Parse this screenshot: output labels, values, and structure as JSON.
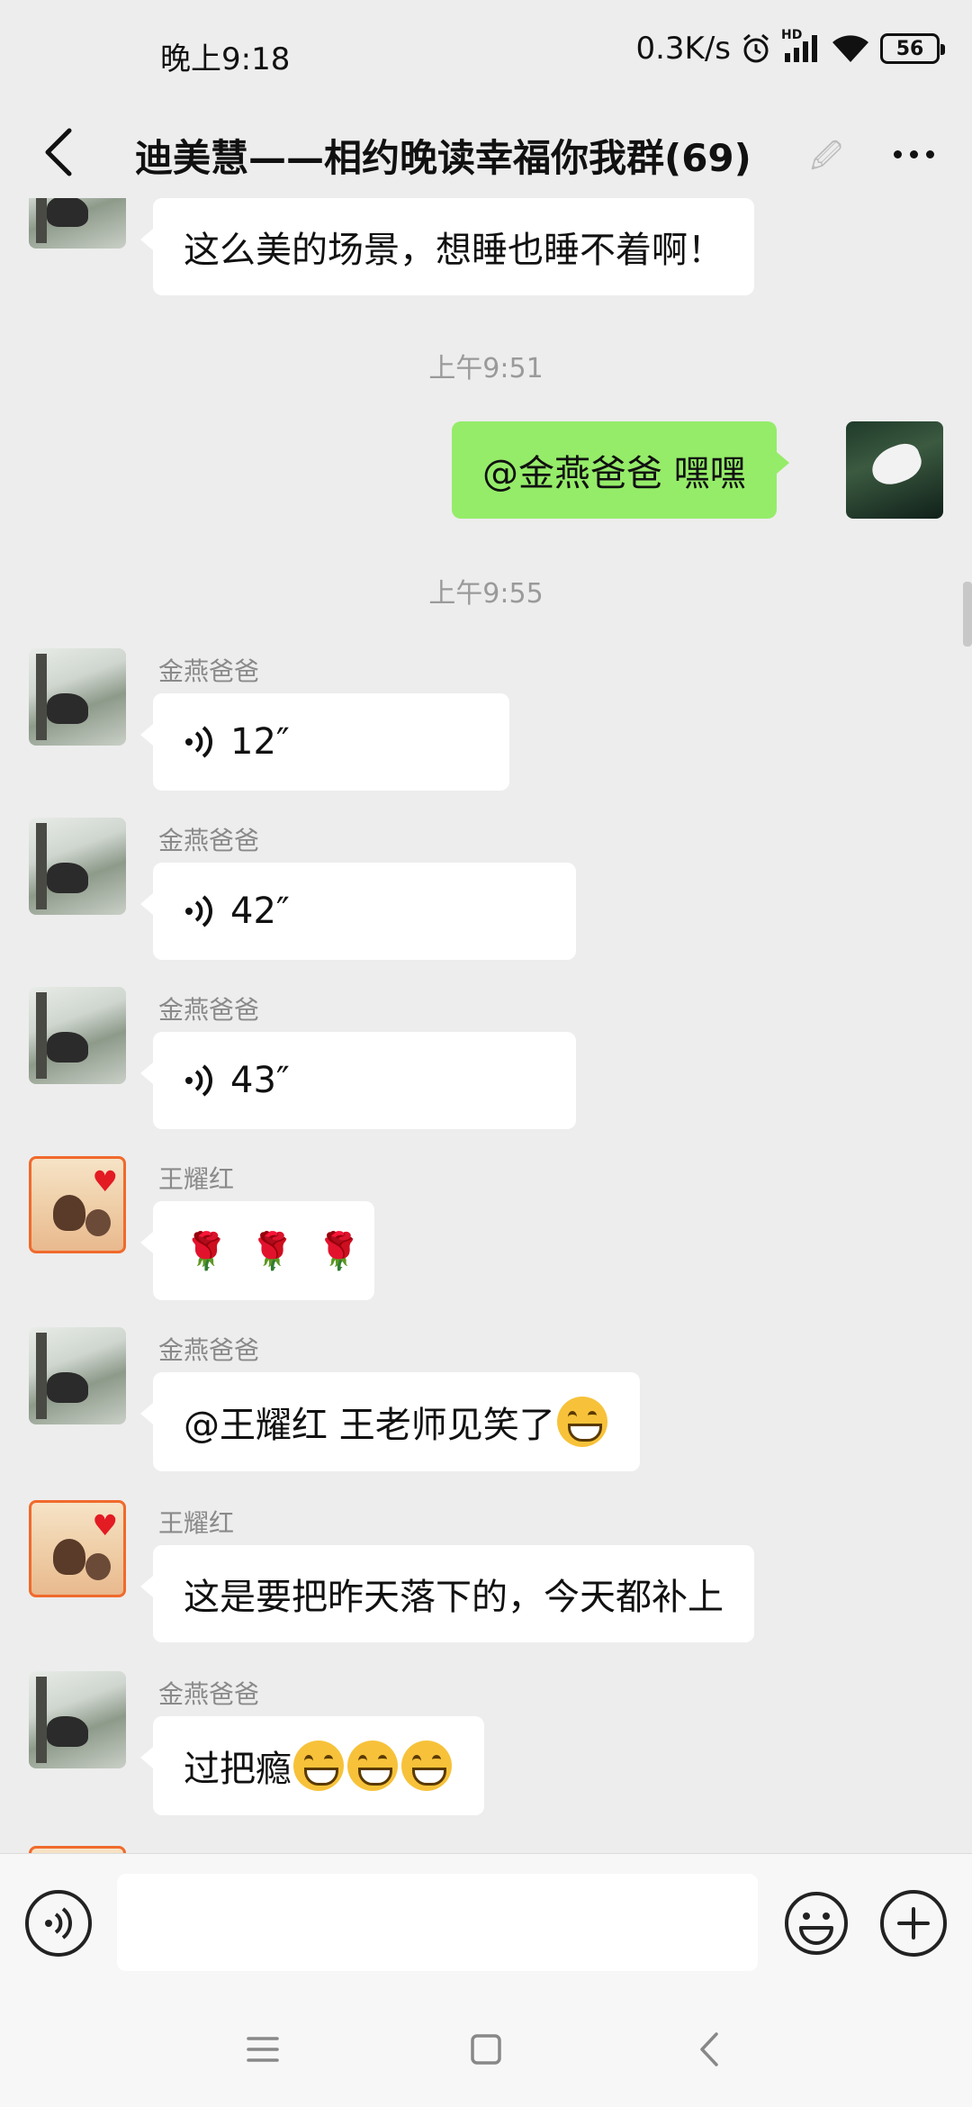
{
  "status_bar": {
    "time": "晚上9:18",
    "network_speed": "0.3K/s",
    "signal_label": "HD",
    "battery": "56",
    "icons": [
      "alarm-icon",
      "signal-icon",
      "wifi-icon",
      "battery-icon"
    ]
  },
  "header": {
    "title": "迪美慧——相约晚读幸福你我群(69)",
    "title_trail": "🖉",
    "icons": [
      "back-arrow-icon",
      "more-dots-icon"
    ]
  },
  "messages": {
    "m0": {
      "text": "这么美的场景，想睡也睡不着啊！"
    },
    "ts1": "上午9:51",
    "m1": {
      "text": "@金燕爸爸  嘿嘿"
    },
    "ts2": "上午9:55",
    "m2": {
      "sender": "金燕爸爸",
      "duration": "12″"
    },
    "m3": {
      "sender": "金燕爸爸",
      "duration": "42″"
    },
    "m4": {
      "sender": "金燕爸爸",
      "duration": "43″"
    },
    "m5": {
      "sender": "王耀红",
      "roses": [
        "🌹",
        "🌹",
        "🌹"
      ]
    },
    "m6": {
      "sender": "金燕爸爸",
      "text": "@王耀红  王老师见笑了"
    },
    "m7": {
      "sender": "王耀红",
      "text": "这是要把昨天落下的，今天都补上"
    },
    "m8": {
      "sender": "金燕爸爸",
      "text": "过把瘾"
    }
  },
  "input_bar": {
    "placeholder": "",
    "icons": [
      "voice-input-icon",
      "emoji-icon",
      "plus-icon"
    ]
  },
  "nav_bar": {
    "icons": [
      "menu-icon",
      "home-icon",
      "back-icon"
    ]
  },
  "colors": {
    "background": "#ededed",
    "own_bubble": "#95ec69",
    "other_bubble": "#ffffff",
    "name_text": "#8a8a8a"
  }
}
